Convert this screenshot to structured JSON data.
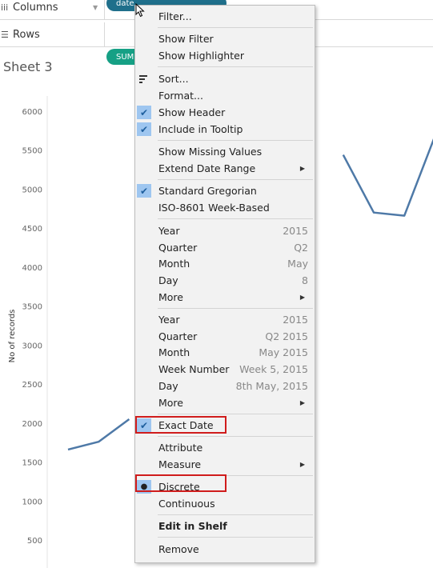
{
  "shelves": {
    "columns_label": "Columns",
    "rows_label": "Rows",
    "columns_pill": "date",
    "rows_pill": "SUM"
  },
  "sheet": {
    "title": "Sheet 3"
  },
  "chart_data": {
    "type": "line",
    "ylabel": "No of records",
    "yticks": [
      500,
      1000,
      1500,
      2000,
      2500,
      3000,
      3500,
      4000,
      4500,
      5000,
      5500,
      6000
    ],
    "ylim": [
      0,
      6200
    ],
    "series": [
      {
        "points": [
          [
            0,
            1660
          ],
          [
            1,
            1760
          ],
          [
            2,
            2050
          ]
        ]
      },
      {
        "points": [
          [
            9,
            5440
          ],
          [
            10,
            4700
          ],
          [
            11,
            4660
          ],
          [
            12,
            5680
          ]
        ]
      }
    ],
    "grid": false
  },
  "menu": {
    "filter": "Filter...",
    "show_filter": "Show Filter",
    "show_highlighter": "Show Highlighter",
    "sort": "Sort...",
    "format": "Format...",
    "show_header": "Show Header",
    "include_tooltip": "Include in Tooltip",
    "show_missing": "Show Missing Values",
    "extend_date": "Extend Date Range",
    "std_gregorian": "Standard Gregorian",
    "iso_week": "ISO-8601 Week-Based",
    "disc": {
      "year": "Year",
      "year_v": "2015",
      "quarter": "Quarter",
      "quarter_v": "Q2",
      "month": "Month",
      "month_v": "May",
      "day": "Day",
      "day_v": "8",
      "more": "More"
    },
    "cont": {
      "year": "Year",
      "year_v": "2015",
      "quarter": "Quarter",
      "quarter_v": "Q2 2015",
      "month": "Month",
      "month_v": "May 2015",
      "week": "Week Number",
      "week_v": "Week 5, 2015",
      "day": "Day",
      "day_v": "8th May, 2015",
      "more": "More"
    },
    "exact_date": "Exact Date",
    "attribute": "Attribute",
    "measure": "Measure",
    "discrete": "Discrete",
    "continuous": "Continuous",
    "edit_in_shelf": "Edit in Shelf",
    "remove": "Remove"
  },
  "colors": {
    "line": "#4e79a7",
    "highlight": "#d01c1c",
    "check_bg": "#9ec6f0"
  }
}
